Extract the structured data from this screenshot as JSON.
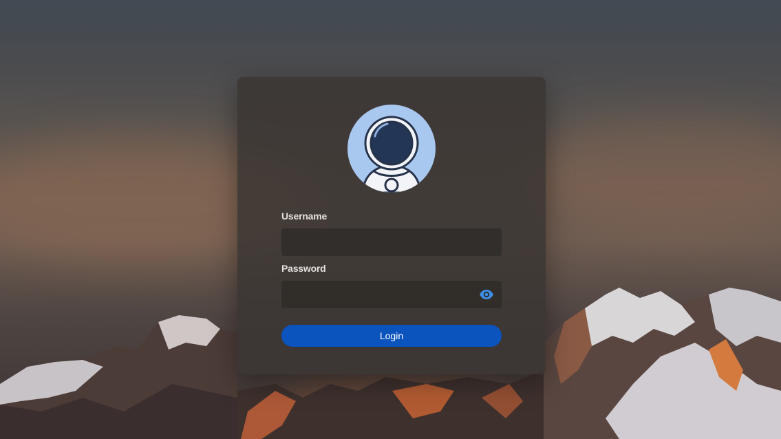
{
  "login_form": {
    "username_label": "Username",
    "username_value": "",
    "password_label": "Password",
    "password_value": "",
    "show_password_icon": "eye-icon",
    "login_label": "Login"
  },
  "avatar": {
    "icon": "astronaut-icon"
  },
  "colors": {
    "accent": "#0b53bd",
    "eye_icon": "#3d8fe6",
    "avatar_bg": "#a9c8f0"
  }
}
